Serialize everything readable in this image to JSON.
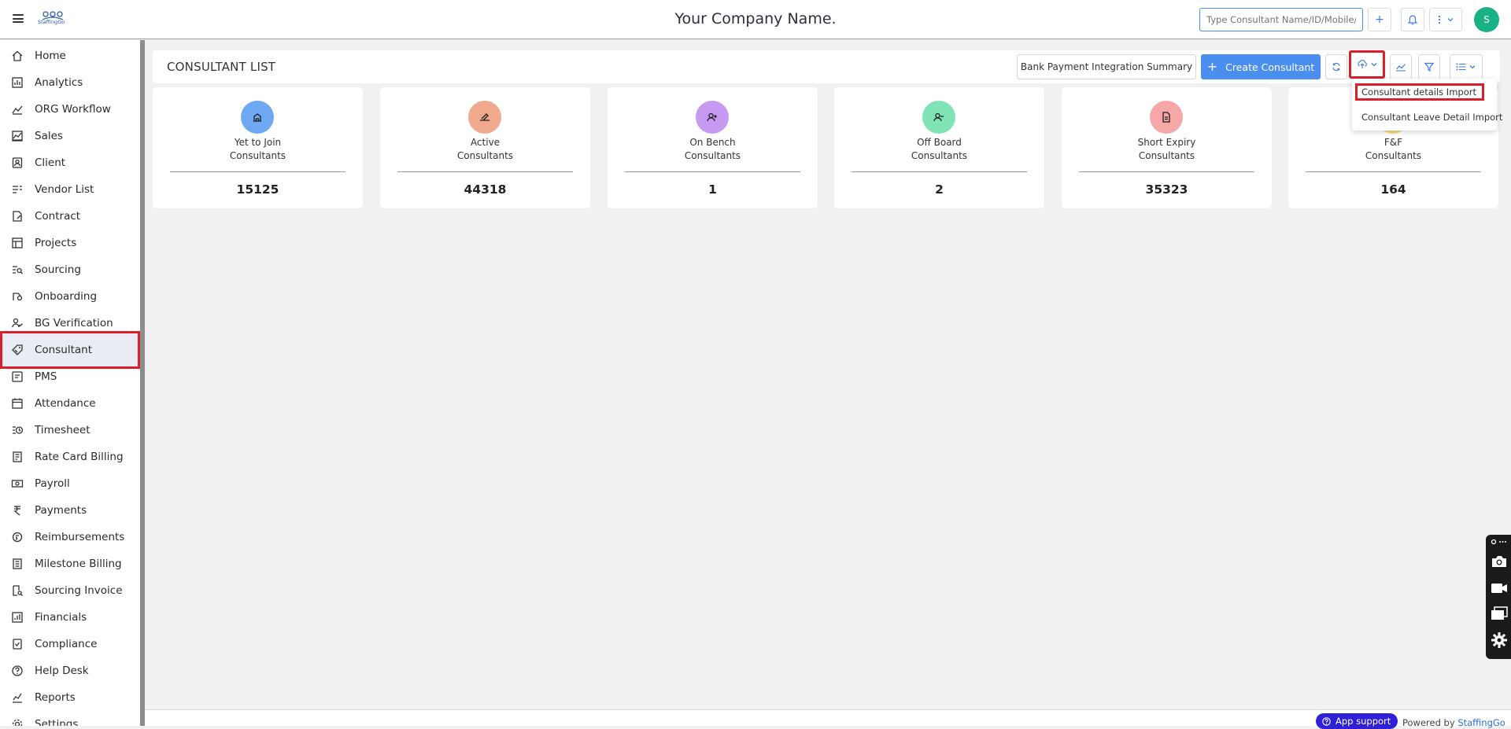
{
  "header": {
    "company_name": "Your Company Name.",
    "logo_text": "StaffingGo",
    "search_placeholder": "Type Consultant Name/ID/Mobile/...",
    "add_label": "+",
    "avatar_initial": "S"
  },
  "sidebar": {
    "items": [
      {
        "label": "Home",
        "icon": "home-icon"
      },
      {
        "label": "Analytics",
        "icon": "analytics-icon"
      },
      {
        "label": "ORG Workflow",
        "icon": "workflow-icon"
      },
      {
        "label": "Sales",
        "icon": "sales-icon"
      },
      {
        "label": "Client",
        "icon": "client-icon"
      },
      {
        "label": "Vendor List",
        "icon": "vendor-list-icon"
      },
      {
        "label": "Contract",
        "icon": "contract-icon"
      },
      {
        "label": "Projects",
        "icon": "projects-icon"
      },
      {
        "label": "Sourcing",
        "icon": "sourcing-icon"
      },
      {
        "label": "Onboarding",
        "icon": "onboarding-icon"
      },
      {
        "label": "BG Verification",
        "icon": "bg-verification-icon"
      },
      {
        "label": "Consultant",
        "icon": "consultant-icon"
      },
      {
        "label": "PMS",
        "icon": "pms-icon"
      },
      {
        "label": "Attendance",
        "icon": "calendar-icon"
      },
      {
        "label": "Timesheet",
        "icon": "timesheet-icon"
      },
      {
        "label": "Rate Card Billing",
        "icon": "rate-card-icon"
      },
      {
        "label": "Payroll",
        "icon": "payroll-icon"
      },
      {
        "label": "Payments",
        "icon": "rupee-icon"
      },
      {
        "label": "Reimbursements",
        "icon": "reimbursements-icon"
      },
      {
        "label": "Milestone Billing",
        "icon": "milestone-icon"
      },
      {
        "label": "Sourcing Invoice",
        "icon": "invoice-search-icon"
      },
      {
        "label": "Financials",
        "icon": "financials-icon"
      },
      {
        "label": "Compliance",
        "icon": "compliance-icon"
      },
      {
        "label": "Help Desk",
        "icon": "help-icon"
      },
      {
        "label": "Reports",
        "icon": "reports-icon"
      },
      {
        "label": "Settings",
        "icon": "settings-icon"
      }
    ],
    "active": "Consultant"
  },
  "list_header": {
    "title": "CONSULTANT LIST",
    "bank_btn": "Bank Payment Integration Summary",
    "create_btn": "Create Consultant"
  },
  "import_menu": {
    "items": [
      "Consultant details Import",
      "Consultant Leave Detail Import"
    ]
  },
  "cards": [
    {
      "line1": "Yet to Join",
      "line2": "Consultants",
      "value": "15125",
      "color": "#6fa8f2",
      "icon": "building-icon"
    },
    {
      "line1": "Active",
      "line2": "Consultants",
      "value": "44318",
      "color": "#f0a98d",
      "icon": "signature-icon"
    },
    {
      "line1": "On Bench",
      "line2": "Consultants",
      "value": "1",
      "color": "#c79af2",
      "icon": "user-plus-icon"
    },
    {
      "line1": "Off Board",
      "line2": "Consultants",
      "value": "2",
      "color": "#7fe3b6",
      "icon": "user-minus-icon"
    },
    {
      "line1": "Short Expiry",
      "line2": "Consultants",
      "value": "35323",
      "color": "#f7a7a7",
      "icon": "document-icon"
    },
    {
      "line1": "F&F",
      "line2": "Consultants",
      "value": "164",
      "color": "#f7dc7f",
      "icon": "coins-icon"
    }
  ],
  "footer": {
    "app_support": "App support",
    "powered_by": "Powered by",
    "brand": "StaffingGo"
  },
  "colors": {
    "accent": "#4a8ff0",
    "highlight": "#dc1e2a",
    "avatar": "#1bb187"
  }
}
